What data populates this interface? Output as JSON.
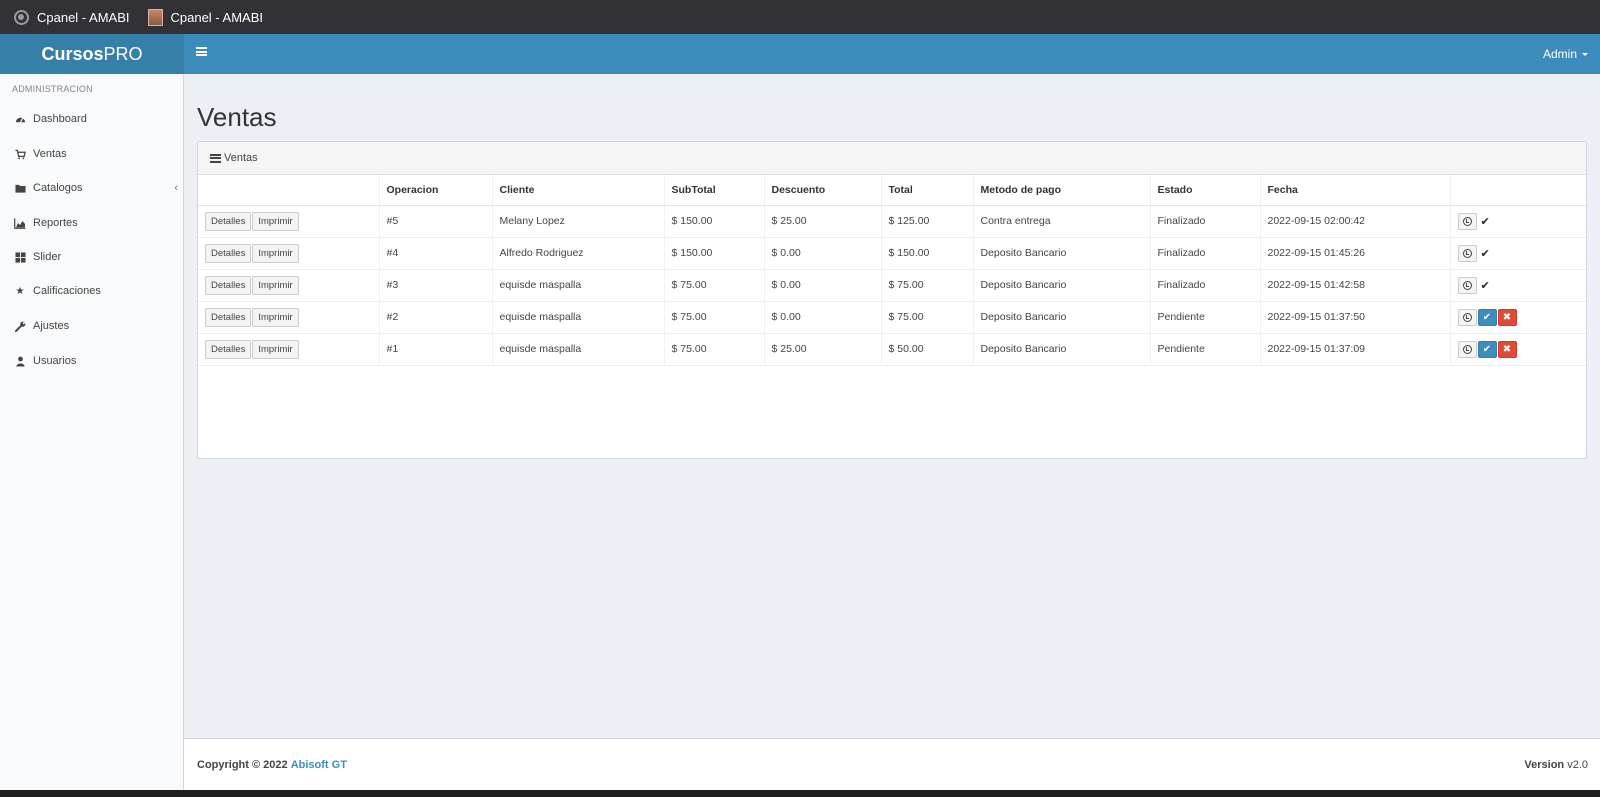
{
  "browser": {
    "tabs": [
      {
        "title": "Cpanel - AMABI",
        "icon": "globe-icon"
      },
      {
        "title": "Cpanel - AMABI",
        "icon": "favicon-image"
      }
    ]
  },
  "header": {
    "logo_bold": "Cursos",
    "logo_light": "PRO",
    "user": "Admin",
    "accent": "#3c8dbc"
  },
  "sidebar": {
    "section_label": "ADMINISTRACION",
    "items": [
      {
        "label": "Dashboard",
        "icon": "dashboard-icon"
      },
      {
        "label": "Ventas",
        "icon": "cart-icon"
      },
      {
        "label": "Catalogos",
        "icon": "folder-icon"
      },
      {
        "label": "Reportes",
        "icon": "area-chart-icon"
      },
      {
        "label": "Slider",
        "icon": "grid-icon"
      },
      {
        "label": "Calificaciones",
        "icon": "star-icon"
      },
      {
        "label": "Ajustes",
        "icon": "wrench-icon"
      },
      {
        "label": "Usuarios",
        "icon": "user-icon"
      }
    ]
  },
  "main": {
    "title": "Ventas",
    "box_title": "Ventas",
    "table": {
      "columns": [
        "",
        "Operacion",
        "Cliente",
        "SubTotal",
        "Descuento",
        "Total",
        "Metodo de pago",
        "Estado",
        "Fecha",
        ""
      ],
      "btn_details": "Detalles",
      "btn_print": "Imprimir",
      "rows": [
        {
          "op": "#5",
          "client": "Melany Lopez",
          "subtotal": "$ 150.00",
          "discount": "$ 25.00",
          "total": "$ 125.00",
          "method": "Contra entrega",
          "status": "Finalizado",
          "date": "2022-09-15 02:00:42"
        },
        {
          "op": "#4",
          "client": "Alfredo Rodriguez",
          "subtotal": "$ 150.00",
          "discount": "$ 0.00",
          "total": "$ 150.00",
          "method": "Deposito Bancario",
          "status": "Finalizado",
          "date": "2022-09-15 01:45:26"
        },
        {
          "op": "#3",
          "client": "equisde maspalla",
          "subtotal": "$ 75.00",
          "discount": "$ 0.00",
          "total": "$ 75.00",
          "method": "Deposito Bancario",
          "status": "Finalizado",
          "date": "2022-09-15 01:42:58"
        },
        {
          "op": "#2",
          "client": "equisde maspalla",
          "subtotal": "$ 75.00",
          "discount": "$ 0.00",
          "total": "$ 75.00",
          "method": "Deposito Bancario",
          "status": "Pendiente",
          "date": "2022-09-15 01:37:50"
        },
        {
          "op": "#1",
          "client": "equisde maspalla",
          "subtotal": "$ 75.00",
          "discount": "$ 25.00",
          "total": "$ 50.00",
          "method": "Deposito Bancario",
          "status": "Pendiente",
          "date": "2022-09-15 01:37:09"
        }
      ]
    }
  },
  "footer": {
    "copyright": "Copyright © 2022",
    "company": "Abisoft GT",
    "version_label": "Version",
    "version": "v2.0"
  }
}
